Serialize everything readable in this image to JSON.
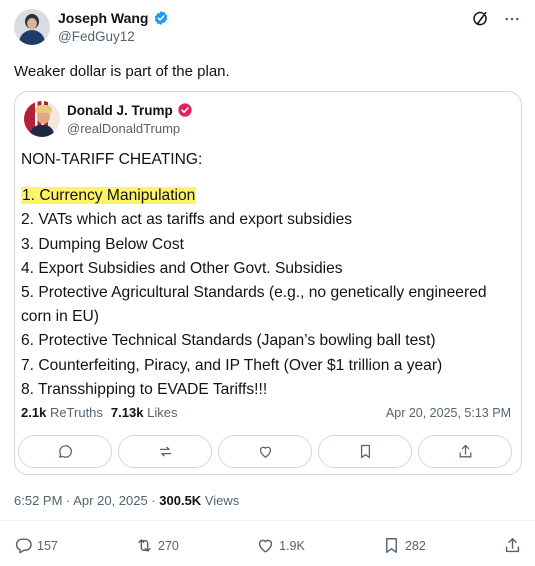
{
  "author": {
    "name": "Joseph Wang",
    "handle": "@FedGuy12"
  },
  "post": {
    "text": "Weaker dollar is part of the plan.",
    "timestamp": "6:52 PM · Apr 20, 2025 ·",
    "views_count": "300.5K",
    "views_label": "Views"
  },
  "quoted": {
    "name": "Donald J. Trump",
    "handle": "@realDonaldTrump",
    "heading": "NON-TARIFF CHEATING:",
    "items": [
      "1. Currency Manipulation",
      "2. VATs which act as tariffs and export subsidies",
      "3. Dumping Below Cost",
      "4. Export Subsidies and Other Govt. Subsidies",
      "5. Protective Agricultural Standards (e.g., no genetically engineered corn in EU)",
      "6. Protective Technical Standards (Japan’s bowling ball test)",
      "7. Counterfeiting, Piracy, and IP Theft (Over $1 trillion a year)",
      "8. Transshipping to EVADE Tariffs!!!"
    ],
    "retruths_count": "2.1k",
    "retruths_label": "ReTruths",
    "likes_count": "7.13k",
    "likes_label": "Likes",
    "timestamp": "Apr 20, 2025, 5:13 PM"
  },
  "actions": {
    "replies": "157",
    "reposts": "270",
    "likes": "1.9K",
    "bookmarks": "282"
  },
  "icons": {
    "verified_blue": "verified-badge-icon",
    "verified_red": "truth-verified-icon",
    "grok": "grok-icon",
    "more": "more-icon"
  },
  "colors": {
    "verified_blue": "#1d9bf0",
    "truth_red": "#e0245e",
    "highlight": "#fff36a"
  }
}
